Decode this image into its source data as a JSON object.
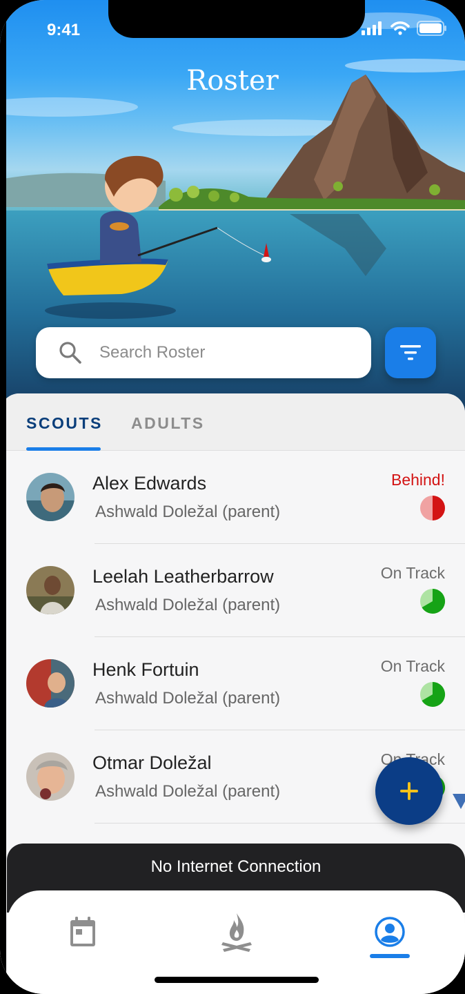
{
  "status_bar": {
    "time": "9:41"
  },
  "header": {
    "title": "Roster"
  },
  "search": {
    "placeholder": "Search Roster"
  },
  "tabs": [
    {
      "label": "SCOUTS",
      "active": true
    },
    {
      "label": "ADULTS",
      "active": false
    }
  ],
  "scouts": [
    {
      "name": "Alex Edwards",
      "parent": "Ashwald Doležal (parent)",
      "status": "Behind!",
      "status_color": "#d31414",
      "progress": 0.25
    },
    {
      "name": "Leelah Leatherbarrow",
      "parent": "Ashwald Doležal (parent)",
      "status": "On Track",
      "status_color": "#16a316",
      "progress": 0.6
    },
    {
      "name": "Henk Fortuin",
      "parent": "Ashwald Doležal (parent)",
      "status": "On Track",
      "status_color": "#16a316",
      "progress": 0.6
    },
    {
      "name": "Otmar Doležal",
      "parent": "Ashwald Doležal (parent)",
      "status": "On Track",
      "status_color": "#16a316",
      "progress": 0.6
    }
  ],
  "snackbar": {
    "message": "No Internet Connection"
  },
  "fab": {
    "icon": "plus-icon",
    "color": "#0b3d86",
    "icon_color": "#f6c21a"
  },
  "bottom_nav": {
    "items": [
      {
        "icon": "calendar-icon",
        "active": false
      },
      {
        "icon": "campfire-icon",
        "active": false
      },
      {
        "icon": "profile-icon",
        "active": true
      }
    ]
  },
  "colors": {
    "accent": "#1a7ee8",
    "tab_active": "#0a3e7a",
    "behind": "#d31414",
    "on_track": "#16a316"
  }
}
